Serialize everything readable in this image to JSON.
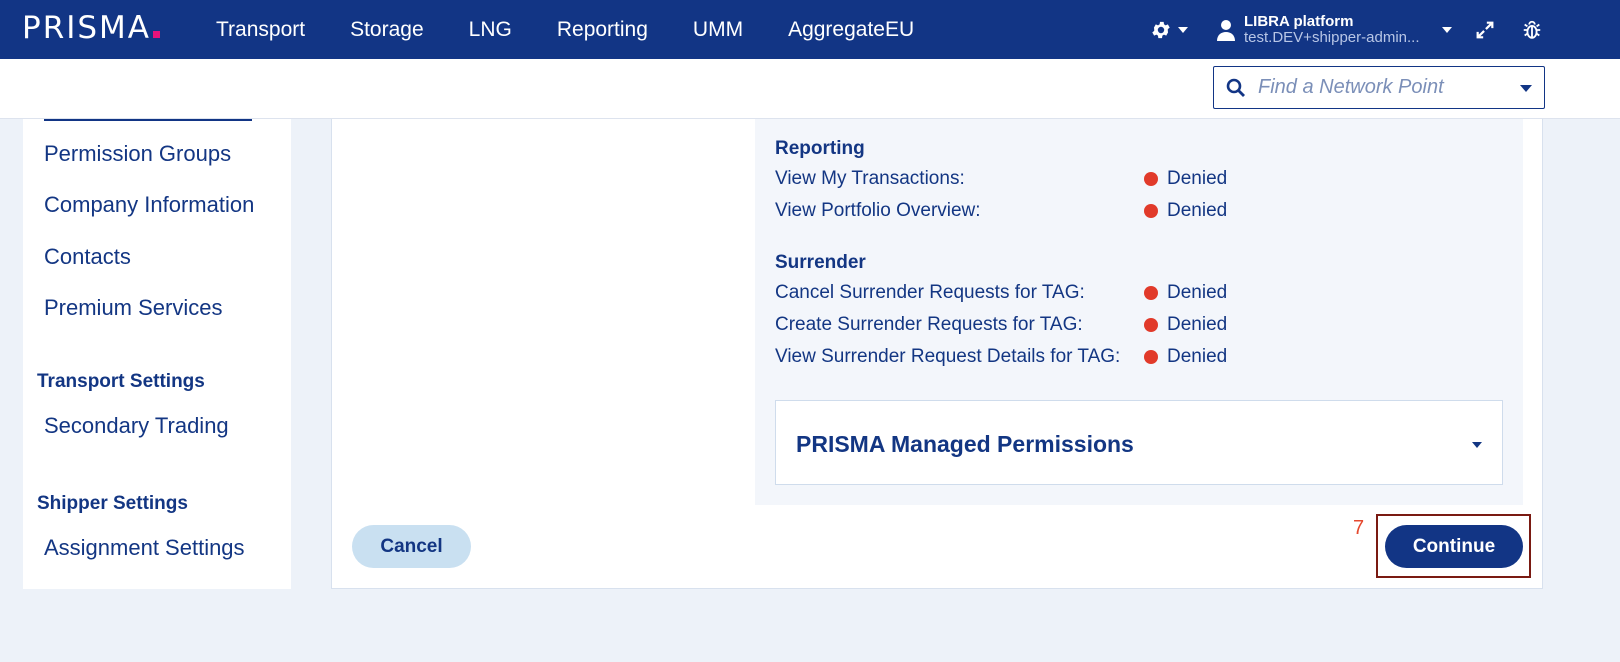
{
  "header": {
    "logo": "PRISMA",
    "nav": [
      "Transport",
      "Storage",
      "LNG",
      "Reporting",
      "UMM",
      "AggregateEU"
    ],
    "user": {
      "name": "LIBRA platform",
      "email": "test.DEV+shipper-admin..."
    },
    "icons": [
      "gear-icon",
      "user-icon",
      "expand-icon",
      "bug-icon"
    ]
  },
  "search": {
    "placeholder": "Find a Network Point"
  },
  "sidebar": {
    "links_top": [
      "Permission Groups",
      "Company Information",
      "Contacts",
      "Premium Services"
    ],
    "transport_heading": "Transport Settings",
    "transport_links": [
      "Secondary Trading"
    ],
    "shipper_heading": "Shipper Settings",
    "shipper_links": [
      "Assignment Settings"
    ]
  },
  "permissions": {
    "reporting": {
      "title": "Reporting",
      "items": [
        {
          "label": "View My Transactions:",
          "status": "Denied"
        },
        {
          "label": "View Portfolio Overview:",
          "status": "Denied"
        }
      ]
    },
    "surrender": {
      "title": "Surrender",
      "items": [
        {
          "label": "Cancel Surrender Requests for TAG:",
          "status": "Denied"
        },
        {
          "label": "Create Surrender Requests for TAG:",
          "status": "Denied"
        },
        {
          "label": "View Surrender Request Details for TAG:",
          "status": "Denied"
        }
      ]
    },
    "managed_title": "PRISMA Managed Permissions"
  },
  "actions": {
    "cancel": "Cancel",
    "continue": "Continue",
    "step_marker": "7"
  },
  "colors": {
    "primary": "#123585",
    "denied": "#e13a2a",
    "marker": "#e5492f"
  }
}
